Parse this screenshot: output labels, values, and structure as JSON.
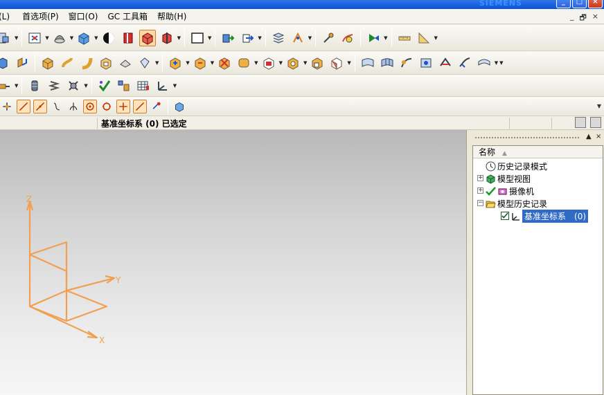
{
  "window": {
    "brand": "SIEMENS",
    "minimize_glyph": "_",
    "maximize_glyph": "□",
    "close_glyph": "×"
  },
  "menu": {
    "items": [
      {
        "label": "(L)"
      },
      {
        "label": "首选项(P)"
      },
      {
        "label": "窗口(O)"
      },
      {
        "label": "GC 工具箱"
      },
      {
        "label": "帮助(H)"
      }
    ],
    "doc_minimize": "_",
    "doc_restore": "🗗",
    "doc_close": "×"
  },
  "cue_line": {
    "selection_status": "基准坐标系 (0) 已选定"
  },
  "viewport": {
    "triad": {
      "x_label": "X",
      "y_label": "Y",
      "z_label": "Z",
      "color": "#f0a050"
    }
  },
  "navigator": {
    "column_header": "名称",
    "sort_indicator": "▲",
    "nodes": [
      {
        "label": "历史记录模式",
        "icon": "clock-icon"
      },
      {
        "label": "模型视图",
        "icon": "model-views-icon",
        "toggle": "+"
      },
      {
        "label": "摄像机",
        "icon": "camera-icon",
        "toggle": "+"
      },
      {
        "label": "模型历史记录",
        "icon": "folder-open-icon",
        "toggle": "−"
      },
      {
        "label": "基准坐标系",
        "count": "(0)",
        "icon": "datum-csys-icon",
        "selected": true
      }
    ]
  },
  "colors": {
    "titlebar": "#0a52d8",
    "selection": "#316ac5",
    "triad": "#f0a050",
    "active_tool": "#fcd9a4"
  }
}
